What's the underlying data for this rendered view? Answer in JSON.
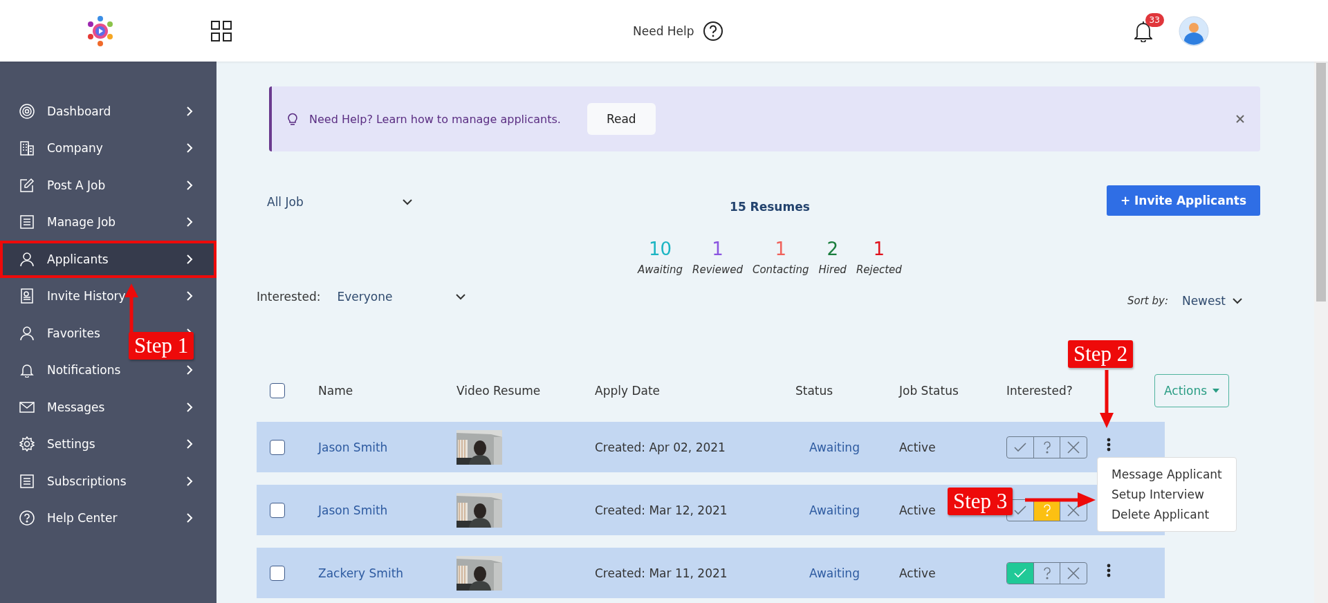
{
  "header": {
    "help_label": "Need Help",
    "notification_count": "33"
  },
  "sidebar": {
    "items": [
      {
        "label": "Dashboard",
        "selected": false,
        "highlighted": false
      },
      {
        "label": "Company",
        "selected": false,
        "highlighted": false
      },
      {
        "label": "Post A Job",
        "selected": false,
        "highlighted": false
      },
      {
        "label": "Manage Job",
        "selected": false,
        "highlighted": false
      },
      {
        "label": "Applicants",
        "selected": true,
        "highlighted": true
      },
      {
        "label": "Invite History",
        "selected": false,
        "highlighted": false
      },
      {
        "label": "Favorites",
        "selected": false,
        "highlighted": false
      },
      {
        "label": "Notifications",
        "selected": false,
        "highlighted": false
      },
      {
        "label": "Messages",
        "selected": false,
        "highlighted": false
      },
      {
        "label": "Settings",
        "selected": false,
        "highlighted": false
      },
      {
        "label": "Subscriptions",
        "selected": false,
        "highlighted": false
      },
      {
        "label": "Help Center",
        "selected": false,
        "highlighted": false
      }
    ]
  },
  "banner": {
    "message": "Need Help? Learn how to manage applicants.",
    "button": "Read"
  },
  "job_filter": {
    "value": "All Job"
  },
  "resume_count": "15 Resumes",
  "invite_button": "+ Invite Applicants",
  "stats": [
    {
      "count": "10",
      "label": "Awaiting",
      "color": "#1cb5c3"
    },
    {
      "count": "1",
      "label": "Reviewed",
      "color": "#8b55e0"
    },
    {
      "count": "1",
      "label": "Contacting",
      "color": "#f0615b"
    },
    {
      "count": "2",
      "label": "Hired",
      "color": "#1a7d3d"
    },
    {
      "count": "1",
      "label": "Rejected",
      "color": "#e0121d"
    }
  ],
  "interested_filter": {
    "label": "Interested:",
    "value": "Everyone"
  },
  "sort": {
    "label": "Sort by:",
    "value": "Newest"
  },
  "actions_button": "Actions",
  "table": {
    "columns": [
      "Name",
      "Video Resume",
      "Apply Date",
      "Status",
      "Job Status",
      "Interested?"
    ],
    "header_checked": false,
    "rows": [
      {
        "checked": false,
        "name": "Jason Smith",
        "apply_date": "Created: Apr 02, 2021",
        "status": "Awaiting",
        "job_status": "Active",
        "interested": [
          {
            "kind": "yes",
            "selected": false
          },
          {
            "kind": "maybe",
            "selected": false
          },
          {
            "kind": "no",
            "selected": false
          }
        ],
        "options_menu": {
          "items": [
            "Message Applicant",
            "Setup Interview",
            "Delete Applicant"
          ]
        }
      },
      {
        "checked": false,
        "name": "Jason Smith",
        "apply_date": "Created: Mar 12, 2021",
        "status": "Awaiting",
        "job_status": "Active",
        "interested": [
          {
            "kind": "yes",
            "selected": false
          },
          {
            "kind": "maybe",
            "selected": true
          },
          {
            "kind": "no",
            "selected": false
          }
        ]
      },
      {
        "checked": false,
        "name": "Zackery Smith",
        "apply_date": "Created: Mar 11, 2021",
        "status": "Awaiting",
        "job_status": "Active",
        "interested": [
          {
            "kind": "yes",
            "selected": true
          },
          {
            "kind": "maybe",
            "selected": false
          },
          {
            "kind": "no",
            "selected": false
          }
        ]
      }
    ]
  },
  "annotations": [
    {
      "label": "Step 1"
    },
    {
      "label": "Step 2"
    },
    {
      "label": "Step 3"
    }
  ]
}
